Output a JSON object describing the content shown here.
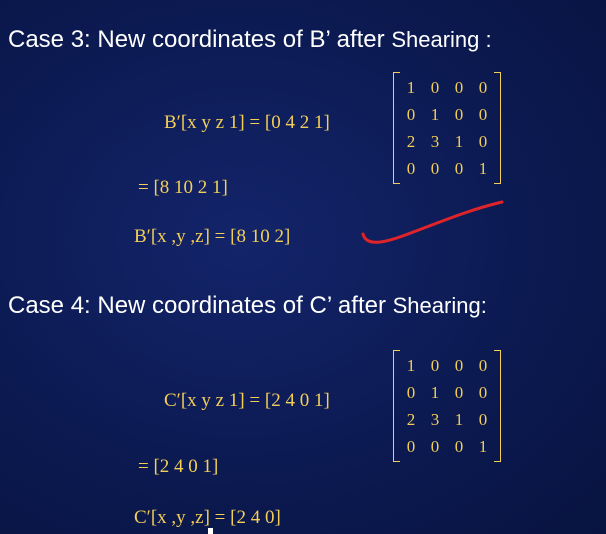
{
  "case3": {
    "heading": "Case 3: New coordinates of B’ after",
    "heading_small": "Shearing :",
    "equation_lhs": "B′[x  y  z  1] = [0  4  2  1]",
    "matrix": [
      [
        "1",
        "0",
        "0",
        "0"
      ],
      [
        "0",
        "1",
        "0",
        "0"
      ],
      [
        "2",
        "3",
        "1",
        "0"
      ],
      [
        "0",
        "0",
        "0",
        "1"
      ]
    ],
    "result": "= [8  10  2  1]",
    "final": "B′[x  ,y  ,z] = [8  10  2]"
  },
  "case4": {
    "heading": "Case 4:  New coordinates of C’ after",
    "heading_small": "Shearing:",
    "equation_lhs": "C′[x  y  z  1] = [2  4  0  1]",
    "matrix": [
      [
        "1",
        "0",
        "0",
        "0"
      ],
      [
        "0",
        "1",
        "0",
        "0"
      ],
      [
        "2",
        "3",
        "1",
        "0"
      ],
      [
        "0",
        "0",
        "0",
        "1"
      ]
    ],
    "result": "= [2  4  0  1]",
    "final": "C′[x  ,y  ,z] = [2  4  0]"
  },
  "colors": {
    "background": "#0c1a52",
    "heading_text": "#ffffff",
    "math_text": "#f3cf57",
    "annotation_stroke": "#e0242a"
  }
}
